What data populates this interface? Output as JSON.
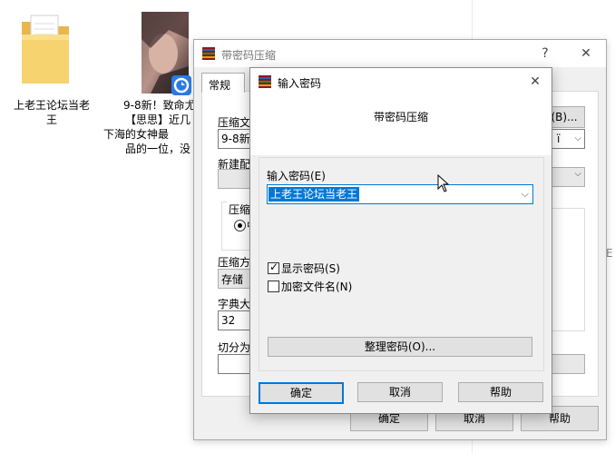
{
  "desktop": {
    "folder_label_line1": "上老王论坛当老",
    "folder_label_line2": "王",
    "video_label_line1": "9-8新！致命尤",
    "video_label_line2": "【思思】近几",
    "video_label_line3": "下海的女神最",
    "video_label_line4": "品的一位，没"
  },
  "bg_window": {
    "title": "带密码压缩",
    "help_glyph": "?",
    "close_glyph": "✕",
    "tab_general": "常规",
    "archive_name_label": "压缩文",
    "archive_name_value": "9-8新",
    "browse_button": "(B)...",
    "combo_tail": "！ï",
    "profile_label": "新建配",
    "compress_group_label": "压缩",
    "compress_method_label": "压缩方",
    "compress_method_value": "存储",
    "dict_label": "字典大",
    "dict_value": "32",
    "split_label": "切分为",
    "ok_button": "确定",
    "cancel_button": "取消",
    "help_button": "帮助"
  },
  "dialog": {
    "title": "输入密码",
    "close_glyph": "✕",
    "heading": "带密码压缩",
    "password_label": "输入密码(E)",
    "password_value": "上老王论坛当老王",
    "show_password": "显示密码(S)",
    "encrypt_filenames": "加密文件名(N)",
    "organize_button": "整理密码(O)...",
    "ok_button": "确定",
    "cancel_button": "取消",
    "help_button": "帮助",
    "show_password_checked": true,
    "encrypt_filenames_checked": false
  }
}
